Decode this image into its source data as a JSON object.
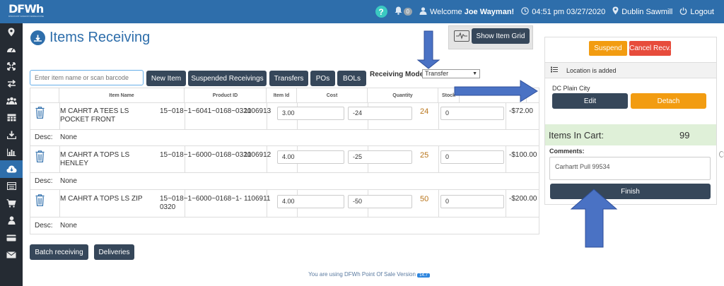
{
  "header": {
    "logo": "DFWh",
    "logo_tagline": "DISCOUNT FASHION WAREHOUSE",
    "help": "?",
    "notification_count": "0",
    "welcome_prefix": "Welcome ",
    "user_name": "Joe Wayman!",
    "datetime": "04:51 pm 03/27/2020",
    "location": "Dublin Sawmill",
    "logout": "Logout"
  },
  "sidebar": {
    "icons": [
      "map-marker-icon",
      "dashboard-icon",
      "expand-icon",
      "transfer-icon",
      "users-icon",
      "table-icon",
      "download-icon",
      "bar-chart-icon",
      "cloud-download-icon",
      "list-icon",
      "cart-icon",
      "user-icon",
      "credit-card-icon",
      "envelope-icon"
    ],
    "active_index": 8
  },
  "page": {
    "title": "Items Receiving"
  },
  "toolbar": {
    "show_item_grid": "Show Item Grid",
    "search_placeholder": "Enter item name or scan barcode",
    "new_item": "New Item",
    "suspended_receivings": "Suspended Receivings",
    "transfers": "Transfers",
    "pos": "POs",
    "bols": "BOLs",
    "receiving_mode_label": "Receiving Mode",
    "receiving_mode_value": "Transfer"
  },
  "table": {
    "headers": [
      "Item Name",
      "Product ID",
      "Item Id",
      "Cost",
      "Quantity",
      "Stock"
    ],
    "desc_label": "Desc:",
    "rows": [
      {
        "name": "M CAHRT A TEES LS POCKET FRONT",
        "product_id": "15~018~1~6041~0168~0320",
        "item_id": "1106913",
        "cost": "3.00",
        "quantity": "-24",
        "stock": "24",
        "discount": "0",
        "total": "-$72.00",
        "desc": "None"
      },
      {
        "name": "M CAHRT A TOPS LS HENLEY",
        "product_id": "15~018~1~6000~0168~0320",
        "item_id": "1106912",
        "cost": "4.00",
        "quantity": "-25",
        "stock": "25",
        "discount": "0",
        "total": "-$100.00",
        "desc": "None"
      },
      {
        "name": "M CAHRT A TOPS LS ZIP",
        "product_id": "15~018~1~6000~0168~1-0320",
        "item_id": "1106911",
        "cost": "4.00",
        "quantity": "-50",
        "stock": "50",
        "discount": "0",
        "total": "-$200.00",
        "desc": "None"
      }
    ]
  },
  "bottom": {
    "batch_receiving": "Batch receiving",
    "deliveries": "Deliveries"
  },
  "panel": {
    "suspend": "Suspend",
    "cancel": "Cancel Recv.",
    "location_msg": "Location is added",
    "location_name": "DC Plain City",
    "edit": "Edit",
    "detach": "Detach",
    "items_in_cart_label": "Items In Cart:",
    "items_in_cart_count": "99",
    "comments_label": "Comments:",
    "comments_value": "Carhartt Pull 99534",
    "finish": "Finish"
  },
  "footer": {
    "text": "You are using DFWh Point Of Sale Version",
    "version": "14.7"
  },
  "colors": {
    "brand_blue": "#2e6eab",
    "dark_button": "#36475a",
    "orange": "#f29c11",
    "red": "#e74c3c",
    "sidebar_bg": "#252b33",
    "cart_green": "#dff0d8",
    "annotation_arrow": "#4a72c4"
  }
}
